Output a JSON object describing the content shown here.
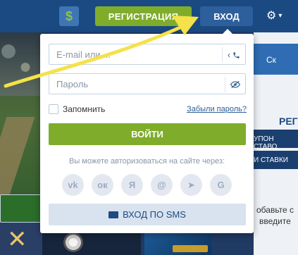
{
  "header": {
    "currency_icon": "dollar-icon",
    "currency_symbol": "$",
    "register_label": "РЕГИСТРАЦИЯ",
    "login_label": "ВХОД",
    "settings_icon": "gear-icon"
  },
  "login_popup": {
    "email_placeholder": "E-mail или ...",
    "email_suffix_icons": [
      "chevron-left-icon",
      "phone-icon"
    ],
    "password_placeholder": "Пароль",
    "password_suffix_icon": "eye-off-icon",
    "remember_label": "Запомнить",
    "forgot_label": "Забыли пароль?",
    "submit_label": "ВОЙТИ",
    "social_caption": "Вы можете авторизоваться на сайте через:",
    "social": [
      {
        "name": "vk-icon",
        "glyph": "vk"
      },
      {
        "name": "odnoklassniki-icon",
        "glyph": "ок"
      },
      {
        "name": "yandex-icon",
        "glyph": "Я"
      },
      {
        "name": "mail-icon",
        "glyph": "@"
      },
      {
        "name": "telegram-icon",
        "glyph": "➤"
      },
      {
        "name": "google-icon",
        "glyph": "G"
      }
    ],
    "sms_label": "ВХОД ПО SMS",
    "sms_icon": "envelope-icon"
  },
  "right_panel": {
    "tab_label": "Ск",
    "title": "РЕГ",
    "coupon_label": "УПОН СТАВО",
    "bets_label": "И СТАВКИ",
    "text_line1": "обавьте с",
    "text_line2": "введите"
  },
  "colors": {
    "header_bg": "#1b4a82",
    "accent_green": "#7fad2b",
    "link_blue": "#2c5d94",
    "arrow_yellow": "#f5e14a"
  }
}
